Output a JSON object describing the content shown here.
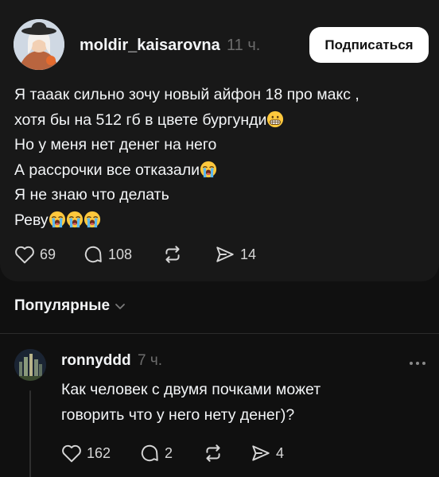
{
  "post": {
    "username": "moldir_kaisarovna",
    "time": "11 ч.",
    "follow_label": "Подписаться",
    "lines": [
      "Я тааак сильно зочу новый айфон 18 про макс ,",
      "хотя бы на 512 гб в цвете бургунди",
      "Но у меня нет денег на него",
      "А рассрочки все отказали",
      "Я не знаю что делать",
      "Реву"
    ],
    "emojis": [
      "grimacing-face",
      "loudly-crying-face"
    ],
    "likes": "69",
    "comments": "108",
    "shares": "14"
  },
  "sort": {
    "label": "Популярные"
  },
  "reply": {
    "username": "ronnyddd",
    "time": "7 ч.",
    "lines": [
      "Как человек с двумя почками может",
      "говорить что у него нету денег)?"
    ],
    "likes": "162",
    "comments": "2",
    "shares": "4"
  },
  "colors": {
    "background": "#101010",
    "post_card": "#181818",
    "text": "#f3f5f7",
    "muted": "#6c6c6c",
    "button_bg": "#ffffff"
  }
}
